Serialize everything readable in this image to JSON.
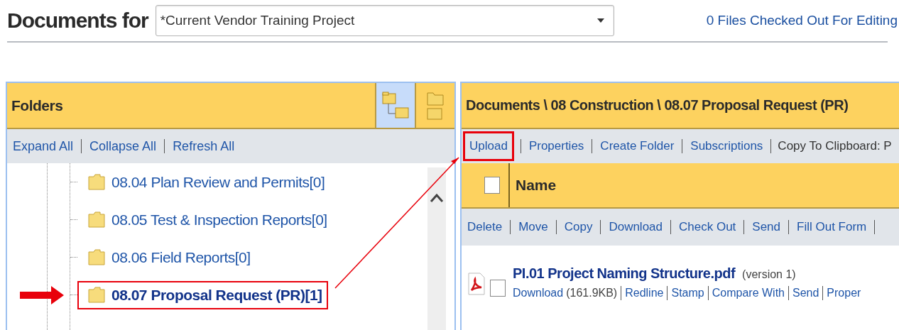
{
  "header": {
    "title": "Documents for",
    "project_select": {
      "value": "*Current Vendor Training Project"
    },
    "checked_out_link": "0 Files Checked Out For Editing"
  },
  "folders_panel": {
    "title": "Folders",
    "view_buttons": [
      {
        "kind": "tree",
        "selected": true
      },
      {
        "kind": "list",
        "selected": false
      }
    ],
    "actions": [
      "Expand All",
      "Collapse All",
      "Refresh All"
    ],
    "tree": [
      {
        "label": "08.04 Plan Review and Permits[0]",
        "selected": false,
        "highlighted": false
      },
      {
        "label": "08.05 Test & Inspection Reports[0]",
        "selected": false,
        "highlighted": false
      },
      {
        "label": "08.06 Field Reports[0]",
        "selected": false,
        "highlighted": false
      },
      {
        "label": "08.07 Proposal Request (PR)[1]",
        "selected": true,
        "highlighted": true
      }
    ]
  },
  "documents_panel": {
    "path": "Documents \\ 08 Construction \\ 08.07 Proposal Request (PR)",
    "toolbar": [
      {
        "label": "Upload",
        "kind": "link",
        "highlighted": true
      },
      {
        "label": "Properties",
        "kind": "link",
        "highlighted": false
      },
      {
        "label": "Create Folder",
        "kind": "link",
        "highlighted": false
      },
      {
        "label": "Subscriptions",
        "kind": "link",
        "highlighted": false
      },
      {
        "label": "Copy To Clipboard: P",
        "kind": "text"
      }
    ],
    "table": {
      "columns": [
        "Name"
      ],
      "select_all_checked": false
    },
    "actions": [
      "Delete",
      "Move",
      "Copy",
      "Download",
      "Check Out",
      "Send",
      "Fill Out Form"
    ],
    "files": [
      {
        "name": "PI.01 Project Naming Structure.pdf",
        "version": "(version 1)",
        "checked": false,
        "links": [
          {
            "label": "Download",
            "note": "(161.9KB)"
          },
          {
            "label": "Redline"
          },
          {
            "label": "Stamp"
          },
          {
            "label": "Compare With"
          },
          {
            "label": "Send"
          },
          {
            "label": "Proper"
          }
        ]
      }
    ]
  },
  "annotations": {
    "connector": true
  }
}
